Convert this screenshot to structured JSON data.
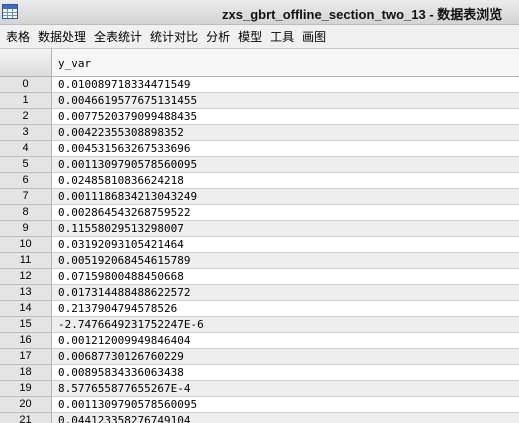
{
  "window": {
    "title": "zxs_gbrt_offline_section_two_13 - 数据表浏览"
  },
  "menu": [
    "表格",
    "数据处理",
    "全表统计",
    "统计对比",
    "分析",
    "模型",
    "工具",
    "画图"
  ],
  "table": {
    "column": "y_var",
    "rows": [
      {
        "index": "0",
        "value": "0.010089718334471549"
      },
      {
        "index": "1",
        "value": "0.0046619577675131455"
      },
      {
        "index": "2",
        "value": "0.0077520379099488435"
      },
      {
        "index": "3",
        "value": "0.00422355308898352"
      },
      {
        "index": "4",
        "value": "0.004531563267533696"
      },
      {
        "index": "5",
        "value": "0.0011309790578560095"
      },
      {
        "index": "6",
        "value": "0.02485810836624218"
      },
      {
        "index": "7",
        "value": "0.0011186834213043249"
      },
      {
        "index": "8",
        "value": "0.002864543268759522"
      },
      {
        "index": "9",
        "value": "0.11558029513298007"
      },
      {
        "index": "10",
        "value": "0.03192093105421464"
      },
      {
        "index": "11",
        "value": "0.005192068454615789"
      },
      {
        "index": "12",
        "value": "0.07159800488450668"
      },
      {
        "index": "13",
        "value": "0.017314488488622572"
      },
      {
        "index": "14",
        "value": "0.2137904794578526"
      },
      {
        "index": "15",
        "value": "-2.747664923175224​7E-6"
      },
      {
        "index": "16",
        "value": "0.001212009949846404"
      },
      {
        "index": "17",
        "value": "0.00687730126760229"
      },
      {
        "index": "18",
        "value": "0.00895834336063438"
      },
      {
        "index": "19",
        "value": "8.577655877655267E-4"
      },
      {
        "index": "20",
        "value": "0.0011309790578560095"
      },
      {
        "index": "21",
        "value": "0.04412335827674910​4"
      }
    ]
  }
}
